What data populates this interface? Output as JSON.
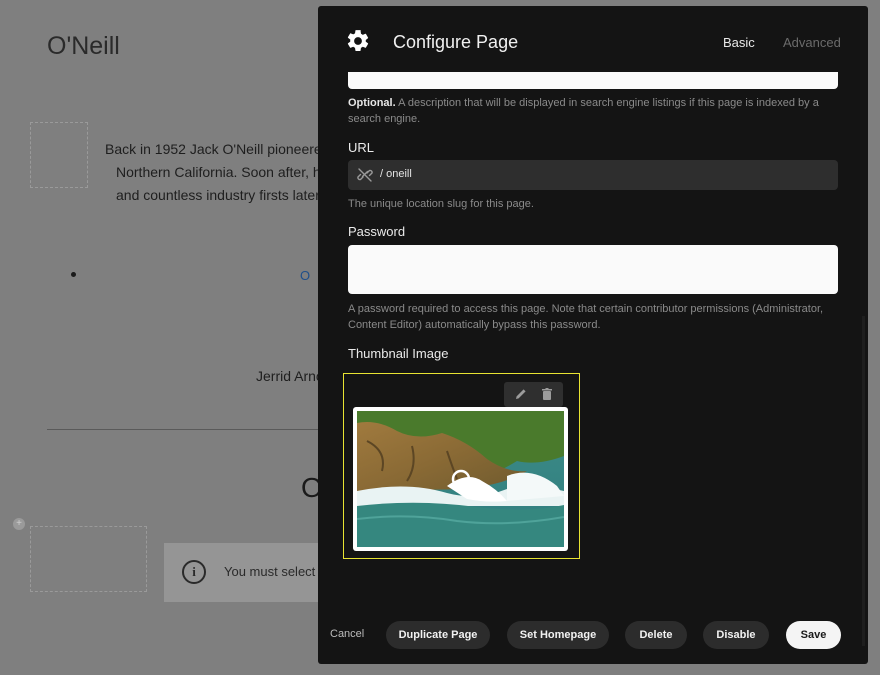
{
  "background": {
    "page_title": "O'Neill",
    "paragraph_lines": [
      "Back in 1952 Jack O'Neill pioneere",
      "Northern California. Soon after, he",
      "and countless industry firsts later,"
    ],
    "link_fragment": "O '",
    "author_fragment": "Jerrid Arno",
    "big_heading_fragment": "O",
    "notice_icon": "i",
    "notice_text": "You must select a",
    "add_icon": "+"
  },
  "modal": {
    "icon": "gear-icon",
    "title": "Configure Page",
    "tabs": [
      {
        "label": "Basic",
        "active": true
      },
      {
        "label": "Advanced",
        "active": false
      }
    ],
    "description": {
      "help_strong": "Optional.",
      "help_text": " A description that will be displayed in search engine listings if this page is indexed by a search engine."
    },
    "url": {
      "label": "URL",
      "value": "/ oneill",
      "icon": "link-off-icon",
      "help": "The unique location slug for this page."
    },
    "password": {
      "label": "Password",
      "value": "",
      "help": "A password required to access this page. Note that certain contributor permissions (Administrator, Content Editor) automatically bypass this password."
    },
    "thumbnail": {
      "label": "Thumbnail Image",
      "edit_icon": "pencil-icon",
      "delete_icon": "trash-icon"
    },
    "footer": {
      "cancel": "Cancel",
      "duplicate": "Duplicate Page",
      "set_homepage": "Set Homepage",
      "delete": "Delete",
      "disable": "Disable",
      "save": "Save"
    }
  },
  "colors": {
    "modal_bg": "#141414",
    "highlight": "#e8e332",
    "save_bg": "#f4f4f4"
  }
}
